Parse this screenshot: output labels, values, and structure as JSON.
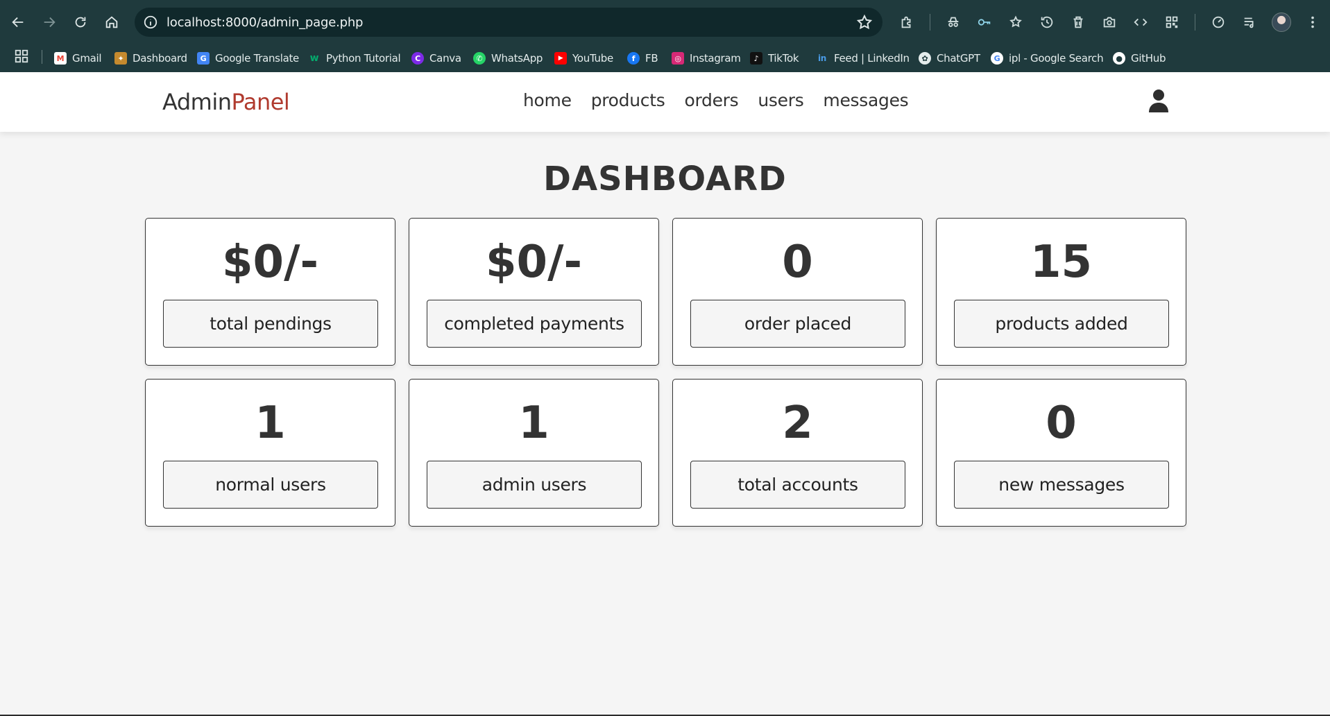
{
  "browser": {
    "url": "localhost:8000/admin_page.php",
    "bookmarks": [
      {
        "label": "Gmail",
        "icon": "gmail-icon",
        "color": "#ea4335",
        "glyph": "M"
      },
      {
        "label": "Dashboard",
        "icon": "dashboard-icon",
        "color": "#c58a2e",
        "glyph": "D"
      },
      {
        "label": "Google Translate",
        "icon": "google-translate-icon",
        "color": "#4285f4",
        "glyph": "G"
      },
      {
        "label": "Python Tutorial",
        "icon": "w3schools-icon",
        "color": "#04aa6d",
        "glyph": "w"
      },
      {
        "label": "Canva",
        "icon": "canva-icon",
        "color": "#7d2ae8",
        "glyph": "C"
      },
      {
        "label": "WhatsApp",
        "icon": "whatsapp-icon",
        "color": "#25d366",
        "glyph": "W"
      },
      {
        "label": "YouTube",
        "icon": "youtube-icon",
        "color": "#ff0000",
        "glyph": "▶"
      },
      {
        "label": "FB",
        "icon": "facebook-icon",
        "color": "#1877f2",
        "glyph": "f"
      },
      {
        "label": "Instagram",
        "icon": "instagram-icon",
        "color": "#d62976",
        "glyph": "◎"
      },
      {
        "label": "TikTok",
        "icon": "tiktok-icon",
        "color": "#111111",
        "glyph": "♪"
      },
      {
        "label": "Feed | LinkedIn",
        "icon": "linkedin-icon",
        "color": "#0a66c2",
        "glyph": "in"
      },
      {
        "label": "ChatGPT",
        "icon": "chatgpt-icon",
        "color": "#4b4b4b",
        "glyph": "✿"
      },
      {
        "label": "ipl - Google Search",
        "icon": "google-icon",
        "color": "#ffffff",
        "glyph": "G"
      },
      {
        "label": "GitHub",
        "icon": "github-icon",
        "color": "#ffffff",
        "glyph": "●"
      }
    ]
  },
  "header": {
    "logo_main": "Admin",
    "logo_accent": "Panel",
    "nav": [
      "home",
      "products",
      "orders",
      "users",
      "messages"
    ]
  },
  "dashboard": {
    "title": "DASHBOARD",
    "cards": [
      {
        "value": "$0/-",
        "label": "total pendings"
      },
      {
        "value": "$0/-",
        "label": "completed payments"
      },
      {
        "value": "0",
        "label": "order placed"
      },
      {
        "value": "15",
        "label": "products added"
      },
      {
        "value": "1",
        "label": "normal users"
      },
      {
        "value": "1",
        "label": "admin users"
      },
      {
        "value": "2",
        "label": "total accounts"
      },
      {
        "value": "0",
        "label": "new messages"
      }
    ]
  },
  "colors": {
    "chrome_bg": "#1f3a3d",
    "logo_accent": "#b03a2e",
    "page_bg": "#f5f5f5"
  }
}
